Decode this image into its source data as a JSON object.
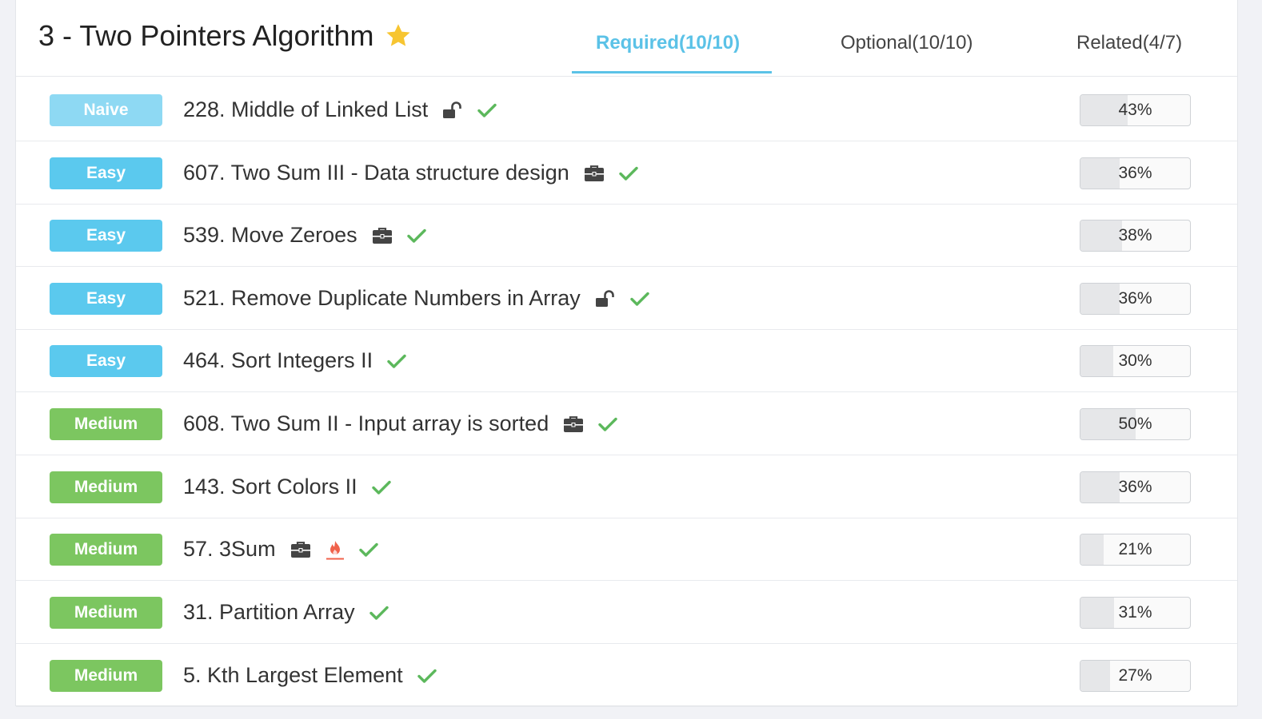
{
  "header": {
    "title": "3 - Two Pointers Algorithm",
    "tabs": [
      {
        "label": "Required(10/10)",
        "active": true
      },
      {
        "label": "Optional(10/10)",
        "active": false
      },
      {
        "label": "Related(4/7)",
        "active": false
      }
    ]
  },
  "colors": {
    "accent": "#5bc2e7",
    "naive": "#8ed9f3",
    "easy": "#5bc9ee",
    "medium": "#7cc660",
    "check": "#5cb85c",
    "hot": "#f0624b",
    "star": "#f7c531"
  },
  "problems": [
    {
      "level": "Naive",
      "title": "228. Middle of Linked List",
      "icons": [
        "unlock-icon",
        "check-icon"
      ],
      "rate": "43%",
      "rate_value": 0.43
    },
    {
      "level": "Easy",
      "title": "607. Two Sum III - Data structure design",
      "icons": [
        "briefcase-icon",
        "check-icon"
      ],
      "rate": "36%",
      "rate_value": 0.36
    },
    {
      "level": "Easy",
      "title": "539. Move Zeroes",
      "icons": [
        "briefcase-icon",
        "check-icon"
      ],
      "rate": "38%",
      "rate_value": 0.38
    },
    {
      "level": "Easy",
      "title": "521. Remove Duplicate Numbers in Array",
      "icons": [
        "unlock-icon",
        "check-icon"
      ],
      "rate": "36%",
      "rate_value": 0.36
    },
    {
      "level": "Easy",
      "title": "464. Sort Integers II",
      "icons": [
        "check-icon"
      ],
      "rate": "30%",
      "rate_value": 0.3
    },
    {
      "level": "Medium",
      "title": "608. Two Sum II - Input array is sorted",
      "icons": [
        "briefcase-icon",
        "check-icon"
      ],
      "rate": "50%",
      "rate_value": 0.5
    },
    {
      "level": "Medium",
      "title": "143. Sort Colors II",
      "icons": [
        "check-icon"
      ],
      "rate": "36%",
      "rate_value": 0.36
    },
    {
      "level": "Medium",
      "title": "57. 3Sum",
      "icons": [
        "briefcase-icon",
        "hot-icon",
        "check-icon"
      ],
      "rate": "21%",
      "rate_value": 0.21
    },
    {
      "level": "Medium",
      "title": "31. Partition Array",
      "icons": [
        "check-icon"
      ],
      "rate": "31%",
      "rate_value": 0.31
    },
    {
      "level": "Medium",
      "title": "5. Kth Largest Element",
      "icons": [
        "check-icon"
      ],
      "rate": "27%",
      "rate_value": 0.27
    }
  ]
}
